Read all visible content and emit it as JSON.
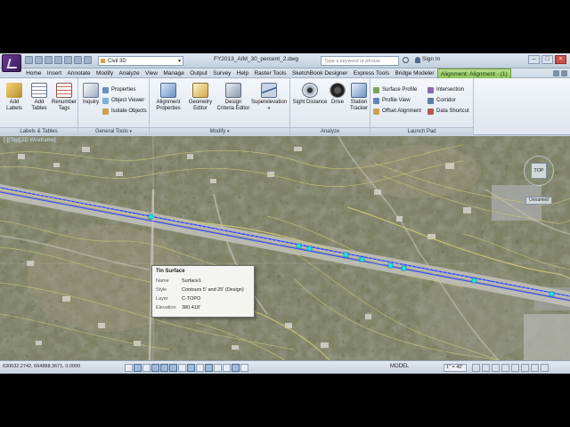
{
  "titlebar": {
    "workspace": "Civil 3D",
    "document": "FY2013_AIM_30_percent_2.dwg",
    "search_placeholder": "Type a keyword or phrase",
    "sign_in": "Sign In"
  },
  "menu": {
    "tabs": [
      "Home",
      "Insert",
      "Annotate",
      "Modify",
      "Analyze",
      "View",
      "Manage",
      "Output",
      "Survey",
      "Help",
      "Raster Tools",
      "SketchBook Designer",
      "Express Tools",
      "Bridge Modeler"
    ],
    "context_tab": "Alignment: Alignment - (1)"
  },
  "ribbon": {
    "labels_tables": {
      "title": "Labels & Tables",
      "add_labels": "Add\nLabels",
      "add_tables": "Add\nTables",
      "renumber_tags": "Renumber\nTags"
    },
    "general_tools": {
      "title": "General Tools",
      "inquiry": "Inquiry",
      "properties": "Properties",
      "object_viewer": "Object Viewer",
      "isolate_objects": "Isolate Objects"
    },
    "modify": {
      "title": "Modify",
      "alignment_properties": "Alignment\nProperties",
      "geometry_editor": "Geometry\nEditor",
      "design_criteria_editor": "Design\nCriteria Editor",
      "superelevation": "Superelevation"
    },
    "analyze": {
      "title": "Analyze",
      "sight_distance": "Sight Distance",
      "drive": "Drive",
      "station_tracker": "Station\nTracker"
    },
    "launch_pad": {
      "title": "Launch Pad",
      "surface_profile": "Surface Profile",
      "profile_view": "Profile View",
      "offset_alignment": "Offset Alignment",
      "intersection": "Intersection",
      "corridor": "Corridor",
      "data_shortcut": "Data Shortcut"
    }
  },
  "viewport": {
    "label": "[-][Top][2D Wireframe]",
    "viewcube": "TOP",
    "wcs": "Unnamed"
  },
  "tooltip": {
    "title": "Tin Surface",
    "rows": [
      {
        "key": "Name",
        "value": "Surface1"
      },
      {
        "key": "Style",
        "value": "Contours 5' and 25' (Design)"
      },
      {
        "key": "Layer",
        "value": "C-TOPO"
      },
      {
        "key": "Elevation",
        "value": "380.418'"
      }
    ]
  },
  "status": {
    "coords": "630632.2742, 664888.3671, 0.0000",
    "model": "MODEL",
    "scale": "1\" = 40'"
  },
  "colors": {
    "ribbon_context": "#8fc35a",
    "alignment": "#2a3cff",
    "contours": "#c8c37a"
  }
}
